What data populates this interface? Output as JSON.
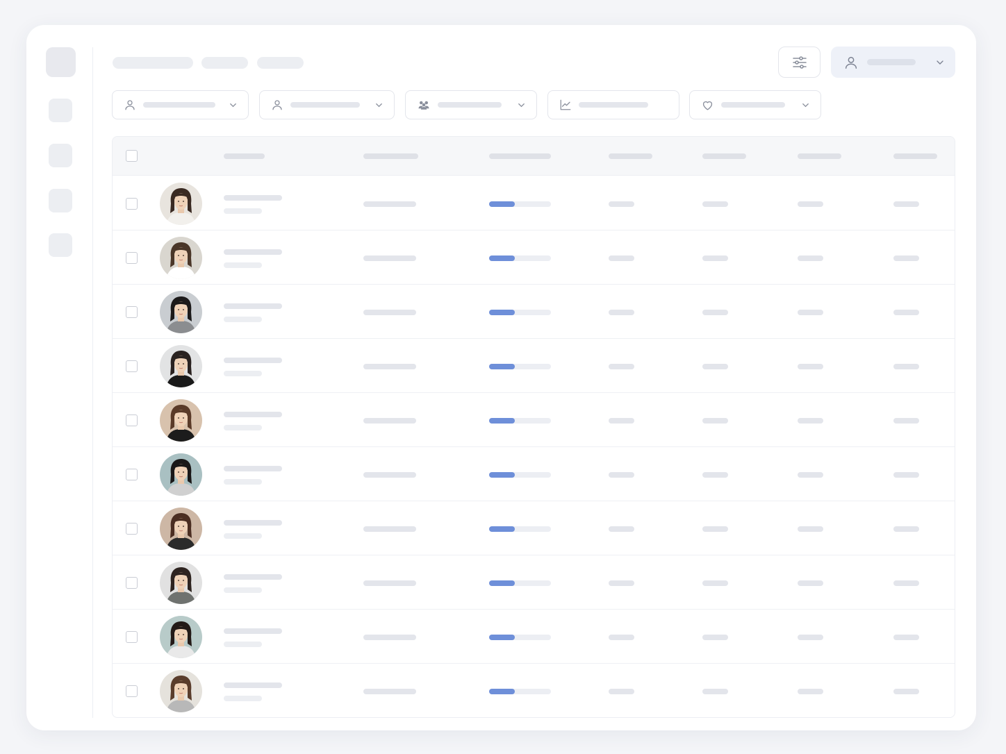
{
  "sidebar": {
    "icons": [
      "dashboard-icon",
      "nav-icon",
      "nav-icon",
      "nav-icon"
    ]
  },
  "toolbar": {
    "filter_settings_icon": "sliders-icon",
    "user_menu_icon": "user-icon",
    "user_menu_chevron": "chevron-down-icon"
  },
  "filters": [
    {
      "icon": "user-icon",
      "has_dropdown": true
    },
    {
      "icon": "user-icon",
      "has_dropdown": true
    },
    {
      "icon": "users-icon",
      "has_dropdown": true
    },
    {
      "icon": "chart-icon",
      "has_dropdown": false
    },
    {
      "icon": "heart-icon",
      "has_dropdown": true
    }
  ],
  "colors": {
    "accent": "#6e8fd9",
    "skeleton": "#e4e6ec",
    "background": "#f4f5f8"
  },
  "table": {
    "row_count": 10,
    "rows": [
      {
        "progress": 0.42,
        "avatar": "avatar-photo"
      },
      {
        "progress": 0.42,
        "avatar": "avatar-photo"
      },
      {
        "progress": 0.42,
        "avatar": "avatar-photo"
      },
      {
        "progress": 0.42,
        "avatar": "avatar-photo"
      },
      {
        "progress": 0.42,
        "avatar": "avatar-photo"
      },
      {
        "progress": 0.42,
        "avatar": "avatar-photo"
      },
      {
        "progress": 0.42,
        "avatar": "avatar-photo"
      },
      {
        "progress": 0.42,
        "avatar": "avatar-photo"
      },
      {
        "progress": 0.42,
        "avatar": "avatar-photo"
      },
      {
        "progress": 0.42,
        "avatar": "avatar-photo"
      }
    ]
  }
}
